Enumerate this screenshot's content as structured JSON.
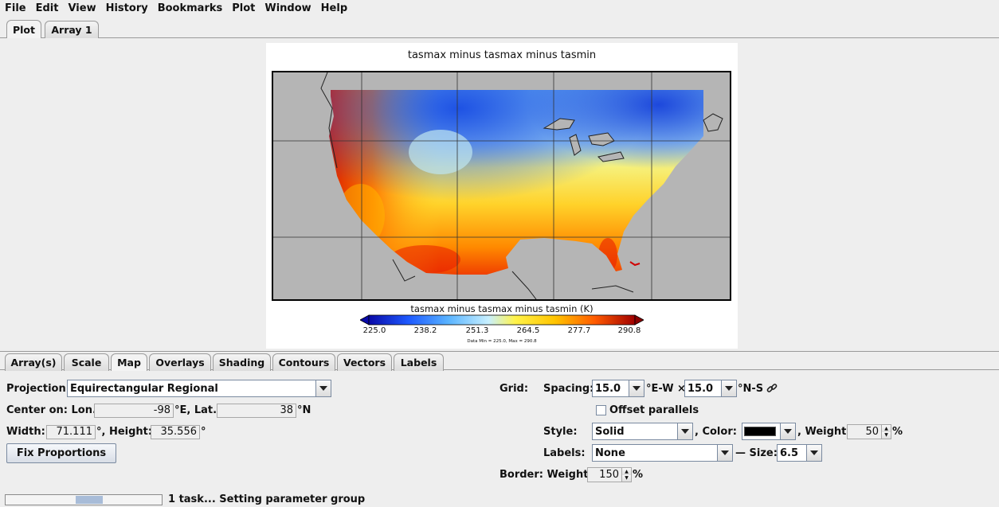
{
  "menubar": [
    "File",
    "Edit",
    "View",
    "History",
    "Bookmarks",
    "Plot",
    "Window",
    "Help"
  ],
  "top_tabs": [
    "Plot",
    "Array 1"
  ],
  "plot": {
    "title": "tasmax minus tasmax minus tasmin",
    "colorbar_title": "tasmax minus tasmax minus tasmin (K)",
    "colorbar_ticks": [
      "225.0",
      "238.2",
      "251.3",
      "264.5",
      "277.7",
      "290.8"
    ],
    "data_minmax": "Data Min = 225.0, Max = 290.8",
    "colors": {
      "ocean": "#b5b5b5",
      "cold": "#0b35d8",
      "mid": "#fff018",
      "hot": "#b40000"
    }
  },
  "bottom_tabs": [
    "Array(s)",
    "Scale",
    "Map",
    "Overlays",
    "Shading",
    "Contours",
    "Vectors",
    "Labels"
  ],
  "map_panel": {
    "projection_label": "Projection:",
    "projection_value": "Equirectangular Regional",
    "center_label": "Center on: Lon.",
    "center_lon": "-98",
    "lon_unit": "°E, Lat.",
    "center_lat": "38",
    "lat_unit": "°N",
    "width_label": "Width:",
    "width_value": "71.111",
    "width_unit": "°, Height:",
    "height_value": "35.556",
    "height_unit": "°",
    "fix_button": "Fix Proportions",
    "grid_label": "Grid:",
    "spacing_label": "Spacing:",
    "spacing_ew": "15.0",
    "ew_unit": "°E-W ×",
    "spacing_ns": "15.0",
    "ns_unit": "°N-S",
    "offset_label": "Offset parallels",
    "style_label": "Style:",
    "style_value": "Solid",
    "color_label": ", Color:",
    "weight_label": ", Weight:",
    "weight_value": "50",
    "weight_unit": "%",
    "labels_label": "Labels:",
    "labels_value": "None",
    "size_label": "— Size:",
    "size_value": "6.5",
    "border_label": "Border: Weight:",
    "border_value": "150",
    "border_unit": "%"
  },
  "status": {
    "text": "1 task... Setting parameter group"
  }
}
